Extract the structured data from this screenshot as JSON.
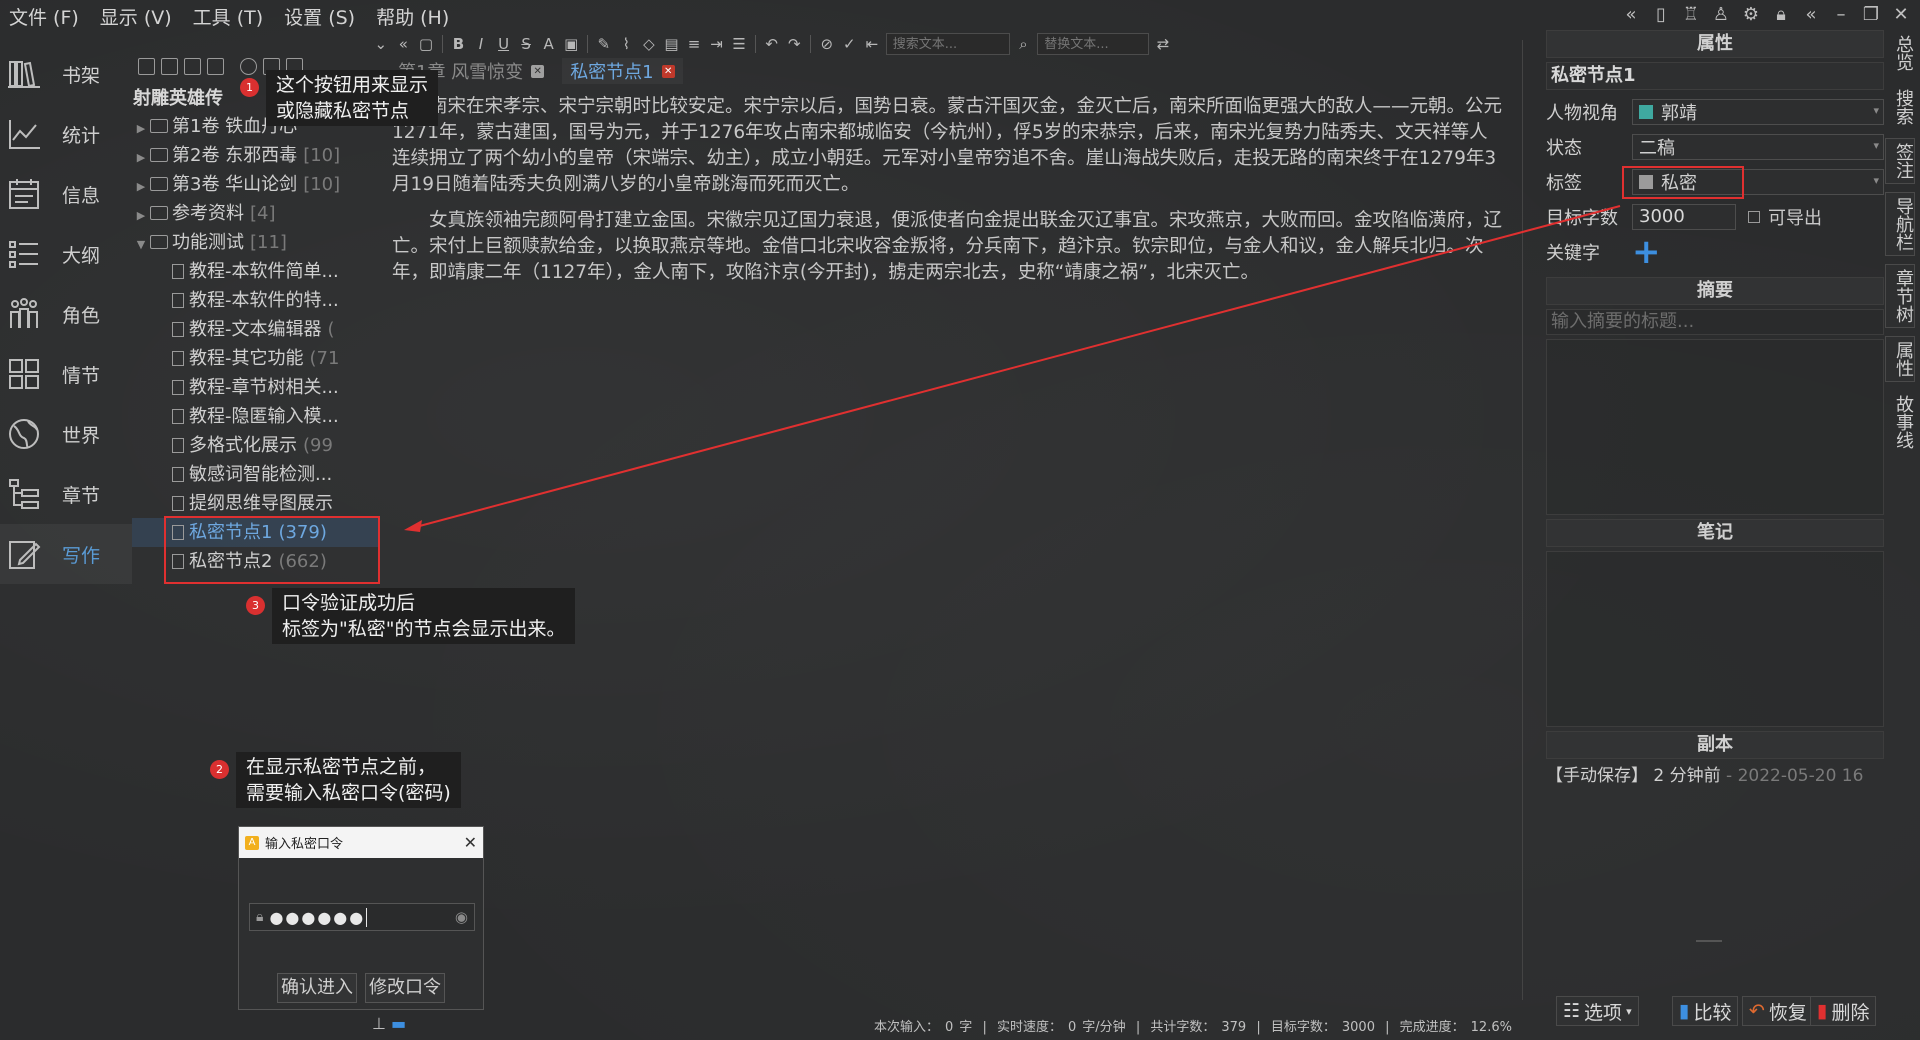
{
  "menu": [
    "文件 (F)",
    "显示 (V)",
    "工具 (T)",
    "设置 (S)",
    "帮助 (H)"
  ],
  "nav": [
    {
      "label": "书架",
      "icon": "bookshelf-icon"
    },
    {
      "label": "统计",
      "icon": "chart-icon"
    },
    {
      "label": "信息",
      "icon": "calendar-icon"
    },
    {
      "label": "大纲",
      "icon": "list-icon"
    },
    {
      "label": "角色",
      "icon": "people-icon"
    },
    {
      "label": "情节",
      "icon": "grid-icon"
    },
    {
      "label": "世界",
      "icon": "globe-icon"
    },
    {
      "label": "章节",
      "icon": "chapter-tree-icon"
    },
    {
      "label": "写作",
      "icon": "pencil-icon"
    }
  ],
  "tree": {
    "book_title": "射雕英雄传",
    "items": [
      {
        "label": "第1卷 铁血丹心",
        "count": "",
        "type": "folder"
      },
      {
        "label": "第2卷 东邪西毒",
        "count": "[10]",
        "type": "folder"
      },
      {
        "label": "第3卷 华山论剑",
        "count": "[10]",
        "type": "folder"
      },
      {
        "label": "参考资料",
        "count": "[4]",
        "type": "folder"
      },
      {
        "label": "功能测试",
        "count": "[11]",
        "type": "folder-open"
      },
      {
        "label": "教程-本软件简单...",
        "count": "",
        "type": "doc"
      },
      {
        "label": "教程-本软件的特...",
        "count": "",
        "type": "doc"
      },
      {
        "label": "教程-文本编辑器",
        "count": "(",
        "type": "doc"
      },
      {
        "label": "教程-其它功能",
        "count": "(71",
        "type": "doc"
      },
      {
        "label": "教程-章节树相关...",
        "count": "",
        "type": "doc"
      },
      {
        "label": "教程-隐匿输入模...",
        "count": "",
        "type": "doc"
      },
      {
        "label": "多格式化展示",
        "count": "(99",
        "type": "doc"
      },
      {
        "label": "敏感词智能检测...",
        "count": "",
        "type": "doc"
      },
      {
        "label": "提纲思维导图展示",
        "count": "",
        "type": "doc"
      },
      {
        "label": "私密节点1",
        "count": "(379)",
        "type": "doc",
        "selected": true
      },
      {
        "label": "私密节点2",
        "count": "(662)",
        "type": "doc"
      }
    ]
  },
  "search": {
    "find_placeholder": "搜索文本...",
    "replace_placeholder": "替换文本..."
  },
  "tabs": [
    {
      "label": "第1章 风雪惊变",
      "active": false
    },
    {
      "label": "私密节点1",
      "active": true
    }
  ],
  "editor": {
    "paragraphs": [
      "南宋在宋孝宗、宋宁宗朝时比较安定。宋宁宗以后，国势日衰。蒙古汗国灭金，金灭亡后，南宋所面临更强大的敌人——元朝。公元1271年，蒙古建国，国号为元，并于1276年攻占南宋都城临安（今杭州），俘5岁的宋恭宗，后来，南宋光复势力陆秀夫、文天祥等人连续拥立了两个幼小的皇帝（宋端宗、幼主），成立小朝廷。元军对小皇帝穷追不舍。崖山海战失败后，走投无路的南宋终于在1279年3月19日随着陆秀夫负刚满八岁的小皇帝跳海而死而灭亡。",
      "女真族领袖完颜阿骨打建立金国。宋徽宗见辽国力衰退，便派使者向金提出联金灭辽事宜。宋攻燕京，大败而回。金攻陷临潢府，辽亡。宋付上巨额赎款给金，以换取燕京等地。金借口北宋收容金叛将，分兵南下，趋汴京。钦宗即位，与金人和议，金人解兵北归。次年，即靖康二年（1127年），金人南下，攻陷汴京(今开封)，掳走两宗北去，史称“靖康之祸”，北宋灭亡。"
    ]
  },
  "props": {
    "header": "属性",
    "node_title": "私密节点1",
    "pov_label": "人物视角",
    "pov_value": "郭靖",
    "pov_color": "#3fa9a0",
    "status_label": "状态",
    "status_value": "二稿",
    "tag_label": "标签",
    "tag_value": "私密",
    "tag_color": "#9b9b9b",
    "target_label": "目标字数",
    "target_value": "3000",
    "exportable_label": "可导出",
    "keyword_label": "关键字",
    "summary_header": "摘要",
    "summary_placeholder": "输入摘要的标题...",
    "notes_header": "笔记",
    "copy_header": "副本",
    "copy_entry_tag": "【手动保存】",
    "copy_entry_time": "2 分钟前",
    "copy_entry_date": "- 2022-05-20 16"
  },
  "vtabs": [
    "总览",
    "搜索",
    "签注",
    "导航栏",
    "章节树",
    "属性",
    "故事线"
  ],
  "bottom_buttons": {
    "options": "选项",
    "compare": "比较",
    "restore": "恢复",
    "delete": "删除"
  },
  "status": {
    "input_label": "本次输入：",
    "input_value": "0",
    "input_unit": "字",
    "speed_label": "实时速度：",
    "speed_value": "0",
    "speed_unit": "字/分钟",
    "total_label": "共计字数：",
    "total_value": "379",
    "target_label": "目标字数：",
    "target_value": "3000",
    "progress_label": "完成进度：",
    "progress_value": "12.6%"
  },
  "callouts": {
    "c1_num": "1",
    "c1_line1": "这个按钮用来显示",
    "c1_line2": "或隐藏私密节点",
    "c2_num": "2",
    "c2_line1": "在显示私密节点之前，",
    "c2_line2": "需要输入私密口令(密码)",
    "c3_num": "3",
    "c3_line1": "口令验证成功后",
    "c3_line2": "标签为\"私密\"的节点会显示出来。"
  },
  "dialog": {
    "title": "输入私密口令",
    "logo": "A",
    "password_mask": "●●●●●●",
    "confirm": "确认进入",
    "change": "修改口令"
  },
  "colors": {
    "accent": "#6ea8e0",
    "annotation_red": "#e03030"
  }
}
